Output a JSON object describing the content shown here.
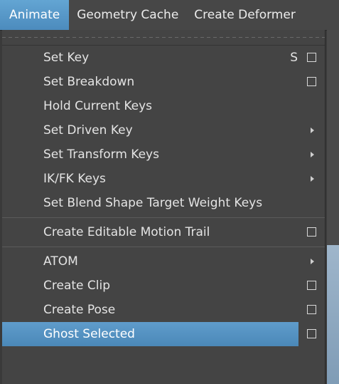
{
  "menubar": {
    "items": [
      {
        "label": "Animate",
        "active": true
      },
      {
        "label": "Geometry Cache",
        "active": false
      },
      {
        "label": "Create Deformer",
        "active": false
      }
    ]
  },
  "menu": {
    "items": [
      {
        "label": "Set Key",
        "shortcut": "S",
        "option_box": true
      },
      {
        "label": "Set Breakdown",
        "option_box": true
      },
      {
        "label": "Hold Current Keys"
      },
      {
        "label": "Set Driven Key",
        "submenu": true
      },
      {
        "label": "Set Transform Keys",
        "submenu": true
      },
      {
        "label": "IK/FK Keys",
        "submenu": true
      },
      {
        "label": "Set Blend Shape Target Weight Keys"
      },
      {
        "label": "Create Editable Motion Trail",
        "option_box": true
      },
      {
        "label": "ATOM",
        "submenu": true
      },
      {
        "label": "Create Clip",
        "option_box": true
      },
      {
        "label": "Create Pose",
        "option_box": true
      },
      {
        "label": "Ghost Selected",
        "option_box": true,
        "highlighted": true
      }
    ]
  },
  "colors": {
    "menubar_bg": "#474747",
    "menu_bg": "#444444",
    "highlight": "#5598c8",
    "text": "#e4e4e4"
  }
}
